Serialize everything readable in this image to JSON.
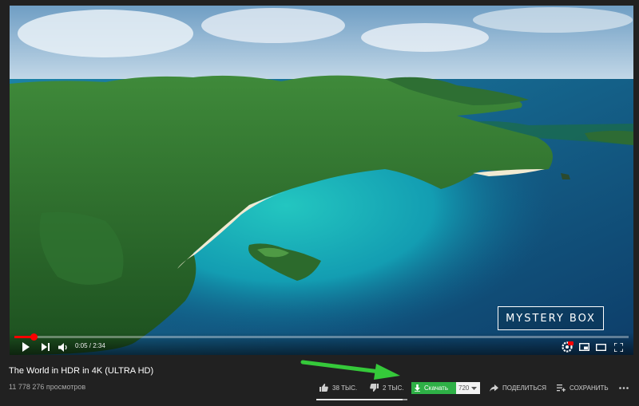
{
  "player": {
    "watermark": "MYSTERY BOX",
    "time_current": "0:05",
    "time_total": "2:34",
    "time_display": "0:05 / 2:34",
    "progress": 0.032,
    "icons": [
      "play-icon",
      "next-icon",
      "volume-icon",
      "settings-hdr-icon",
      "miniplayer-icon",
      "theater-icon",
      "fullscreen-icon"
    ],
    "hdr_badge": "HD"
  },
  "video": {
    "title": "The World in HDR in 4K (ULTRA HD)",
    "views": "11 778 276 просмотров"
  },
  "actions": {
    "likes": "38 ТЫС.",
    "dislikes": "2 ТЫС.",
    "like_ratio": 0.95,
    "download_label": "Скачать",
    "quality": "720",
    "share_label": "ПОДЕЛИТЬСЯ",
    "save_label": "СОХРАНИТЬ"
  },
  "colors": {
    "background": "#212121",
    "progress": "#ff0000",
    "download_button": "#2eb046",
    "annotation_arrow": "#35c93a"
  }
}
